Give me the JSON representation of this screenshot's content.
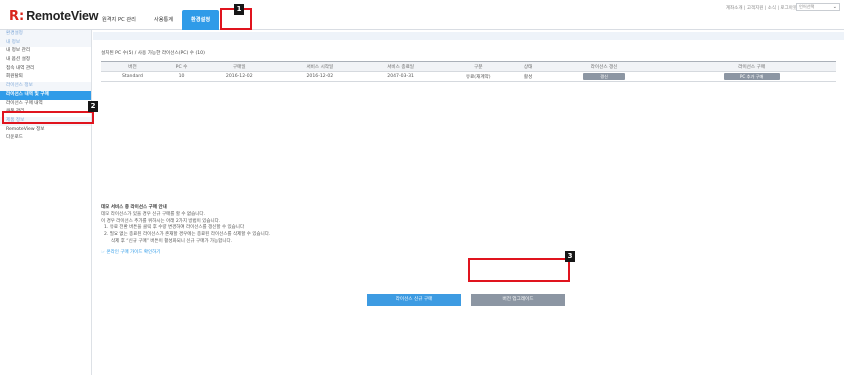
{
  "header": {
    "logo_mark": "R:",
    "logo_text": "RemoteView",
    "nav_tabs": [
      {
        "label": "원격지 PC 관리"
      },
      {
        "label": "사용통계"
      },
      {
        "label": "환경설정"
      }
    ],
    "top_links": "계좌소개 | 고객지원 | 소식 | 로그아웃",
    "lang_select": "언어선택"
  },
  "sidebar": {
    "items": [
      {
        "label": "환경설정"
      },
      {
        "label": "내 정보"
      },
      {
        "label": "내 정보 관리"
      },
      {
        "label": "내 옵션 설정"
      },
      {
        "label": "접속 내역 관리"
      },
      {
        "label": "회원탈퇴"
      },
      {
        "label": "라이선스 정보"
      },
      {
        "label": "라이선스 내역 및 구매"
      },
      {
        "label": "라이선스 구매 내역"
      },
      {
        "label": "쿠폰 관리"
      },
      {
        "label": "제품 정보"
      },
      {
        "label": "RemoteView 정보"
      },
      {
        "label": "다운로드"
      }
    ]
  },
  "content": {
    "count_line": "설치된 PC 수(5) / 사용 가능한 라이선스(PC) 수 (10)",
    "table": {
      "headers": [
        "버전",
        "PC 수",
        "구매일",
        "서비스 시작일",
        "서비스 종료일",
        "구분",
        "상태",
        "라이선스 갱신",
        "라이선스 구매"
      ],
      "row": {
        "version": "Standard",
        "pc_count": "10",
        "purchase_date": "2016-12-02",
        "start_date": "2016-12-02",
        "end_date": "2047-03-31",
        "type": "유료(재계약)",
        "status": "활성",
        "renew_button": "갱신",
        "addpc_button": "PC 추가 구매"
      }
    },
    "notice": {
      "title": "데모 서비스 중 라이선스 구매 안내",
      "lines": [
        "데모 라이선스가 있을 경우 신규 구매를 할 수 없습니다.",
        "이 경우 라이선스 추가를 위하시는 아래 2가지 방법이 있습니다.",
        "1. 유료 전환 버튼을 클릭 후 수량 변경하여 라이선스를 갱신할 수 있습니다",
        "2. 필요 없는 종료된 라이선스가 존재할 경우에는 종료된 라이선스를 삭제할 수 있습니다.",
        "삭제 후 “신규 구매” 버튼이 활성화되니 신규 구매가 가능합니다."
      ],
      "link": "☞ 온라인 구매 가이드 확인하기"
    },
    "buttons": {
      "new_purchase": "라이선스 신규 구매",
      "upgrade": "버전 업그레이드"
    }
  },
  "annotations": [
    "1",
    "2",
    "3"
  ],
  "colors": {
    "accent": "#2f9be8",
    "brand_red": "#d9251c",
    "highlight": "#e0141e",
    "gray_button": "#8c96a3"
  }
}
